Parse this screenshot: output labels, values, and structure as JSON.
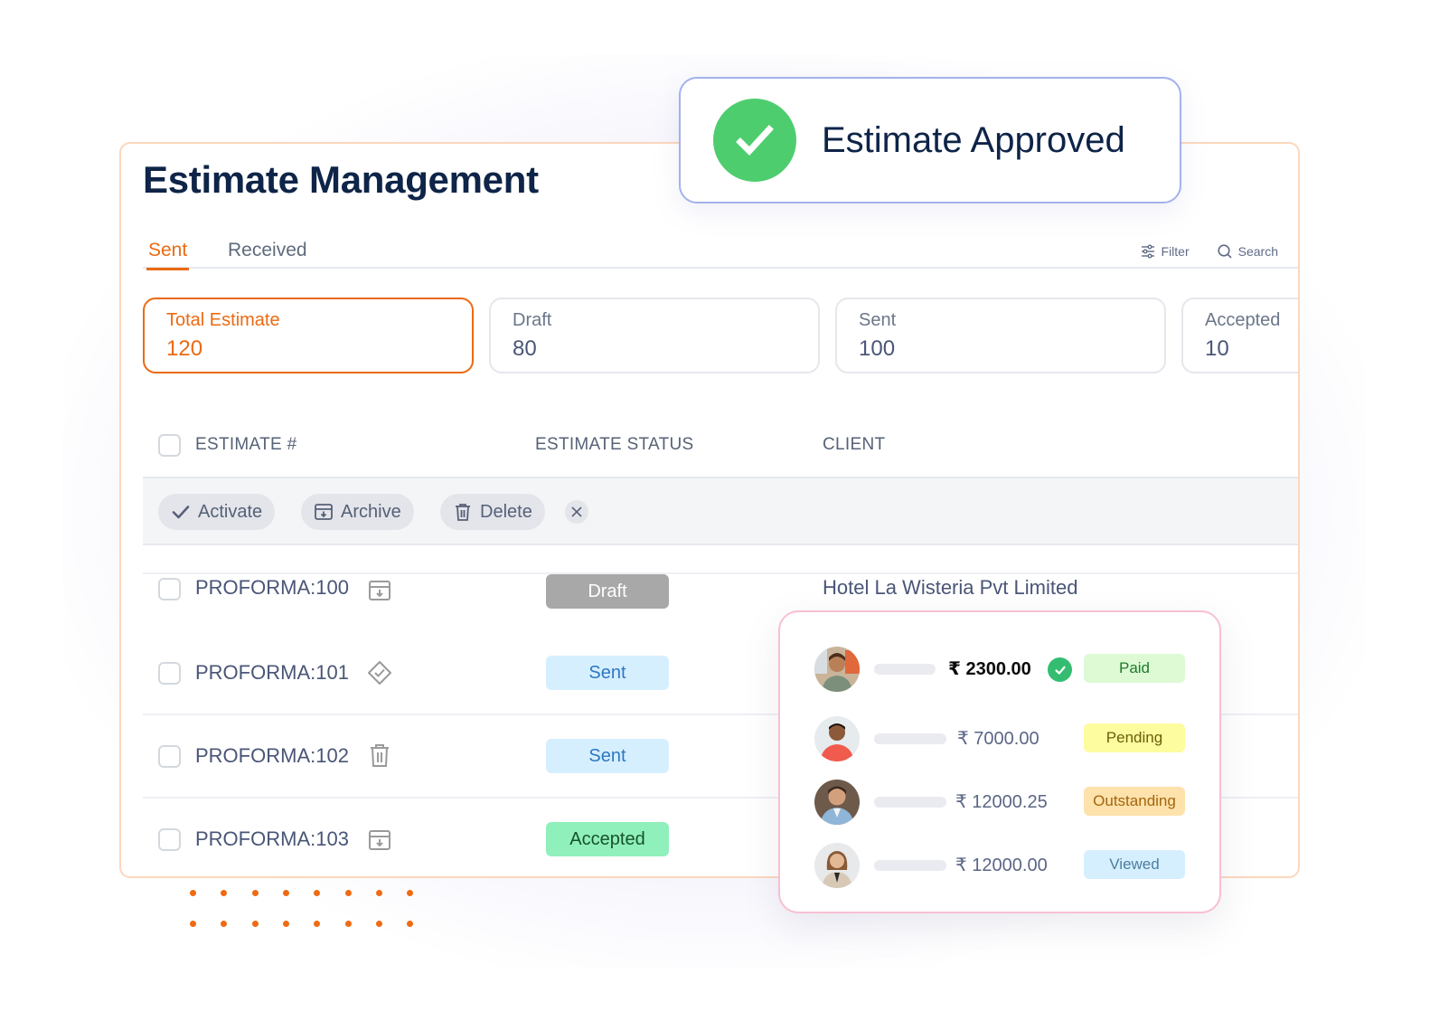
{
  "app": {
    "title": "Estimate Management"
  },
  "tabs": [
    {
      "label": "Sent",
      "active": true
    },
    {
      "label": "Received",
      "active": false
    }
  ],
  "tools": {
    "filter_label": "Filter",
    "search_label": "Search"
  },
  "stats": [
    {
      "label": "Total Estimate",
      "value": "120",
      "active": true
    },
    {
      "label": "Draft",
      "value": "80",
      "active": false
    },
    {
      "label": "Sent",
      "value": "100",
      "active": false
    },
    {
      "label": "Accepted",
      "value": "10",
      "active": false
    }
  ],
  "table": {
    "columns": [
      "ESTIMATE #",
      "ESTIMATE STATUS",
      "CLIENT"
    ],
    "bulk_actions": {
      "activate": "Activate",
      "archive": "Archive",
      "delete": "Delete"
    },
    "rows": [
      {
        "id": "PROFORMA:100",
        "icon": "archive-icon",
        "status": "Draft",
        "client": "Hotel La Wisteria Pvt Limited"
      },
      {
        "id": "PROFORMA:101",
        "icon": "verified-badge-icon",
        "status": "Sent",
        "client": ""
      },
      {
        "id": "PROFORMA:102",
        "icon": "trash-icon",
        "status": "Sent",
        "client": ""
      },
      {
        "id": "PROFORMA:103",
        "icon": "archive-icon",
        "status": "Accepted",
        "client": ""
      }
    ]
  },
  "toast": {
    "message": "Estimate Approved",
    "icon": "check-circle-icon",
    "color": "#4ecd6f"
  },
  "payments": [
    {
      "amount": "₹ 2300.00",
      "status": "Paid",
      "verified": true
    },
    {
      "amount": "₹ 7000.00",
      "status": "Pending",
      "verified": false
    },
    {
      "amount": "₹ 12000.25",
      "status": "Outstanding",
      "verified": false
    },
    {
      "amount": "₹ 12000.00",
      "status": "Viewed",
      "verified": false
    }
  ],
  "colors": {
    "accent": "#ea6a12",
    "title": "#0e2448",
    "draft_bg": "#a8a8a8",
    "sent_bg": "#d6efff",
    "accepted_bg": "#8ff0bb",
    "paid_bg": "#ddfad5",
    "pending_bg": "#fdfc9e",
    "outstanding_bg": "#fde2ac",
    "viewed_bg": "#d6efff"
  }
}
